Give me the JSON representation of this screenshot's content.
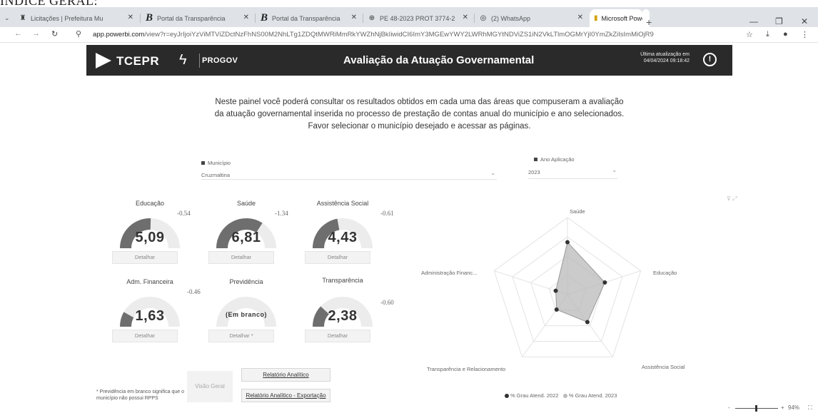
{
  "page_top_text": "ÍNDICE GERAL:",
  "browser": {
    "tabs": [
      {
        "label": "Licitações | Prefeitura Mu",
        "icon": "shield-icon"
      },
      {
        "label": "Portal da Transparência",
        "icon": "b-logo-icon"
      },
      {
        "label": "Portal da Transparência",
        "icon": "b-logo-icon"
      },
      {
        "label": "PE 48-2023 PROT 3774-2",
        "icon": "globe-icon"
      },
      {
        "label": "(2) WhatsApp",
        "icon": "whatsapp-icon"
      },
      {
        "label": "Microsoft Power BI",
        "icon": "powerbi-icon",
        "active": true
      }
    ],
    "url_host": "app.powerbi.com",
    "url_path": "/view?r=eyJrIjoiYzViMTViZDctNzFhNS00M2NhLTg1ZDQtMWRiMmRkYWZhNjBkIiwidCI6ImY3MGEwYWY2LWRhMGYtNDViZS1iN2VkLTlmOGMrYjI0YmZkZiIsImMiOjR9"
  },
  "report": {
    "brand": "TCEPR",
    "brand2": "PROGOV",
    "title": "Avaliação da Atuação Governamental",
    "last_update_label": "Última atualização em",
    "last_update_value": "04/04/2024 09:18:42",
    "intro": [
      "Neste painel você poderá consultar os resultados obtidos em cada uma das áreas que compuseram a avaliação",
      "da atuação governamental inserida no processo de prestação de contas anual do município e ano selecionados.",
      "Favor selecionar o município desejado e acessar as páginas."
    ],
    "slicers": {
      "municipio": {
        "label": "Município",
        "value": "Cruzmaltina"
      },
      "ano": {
        "label": "Ano Aplicação",
        "value": "2023"
      }
    },
    "gauges": [
      {
        "title": "Educação",
        "value": "5,09",
        "delta": "-0.54",
        "fill": 0.509
      },
      {
        "title": "Saúde",
        "value": "6,81",
        "delta": "-1.34",
        "fill": 0.681
      },
      {
        "title": "Assistência Social",
        "value": "4,43",
        "delta": "-0.61",
        "fill": 0.443
      },
      {
        "title": "Adm. Financeira",
        "value": "1,63",
        "delta": "-0.46",
        "fill": 0.163
      },
      {
        "title": "Previdência",
        "value": "(Em branco)",
        "delta": "",
        "fill": 0
      },
      {
        "title": "Transparência",
        "value": "2,38",
        "delta": "-0.60",
        "fill": 0.238
      }
    ],
    "detail_button": "Detalhar",
    "detail_button_prev": "Detalhar *",
    "buttons": {
      "visao_geral": "Visão Geral",
      "relatorio_analitico": "Relatório Analítico",
      "relatorio_exportacao": "Relatório Analítico - Exportação"
    },
    "footnote": "* Previdência em branco significa que o município não possui RPPS",
    "radar": {
      "axes": [
        "Saúde",
        "Educação",
        "Assistência Social",
        "Transparência e Relacionamento",
        "Administração Financ..."
      ],
      "legend": [
        "% Grau Atend. 2022",
        "% Grau Atend. 2023"
      ],
      "series_2022": [
        0.68,
        0.51,
        0.44,
        0.24,
        0.16
      ],
      "colors": {
        "series_2022": "#333333",
        "series_2023": "#b9b9b9"
      }
    },
    "zoom": "94%"
  }
}
